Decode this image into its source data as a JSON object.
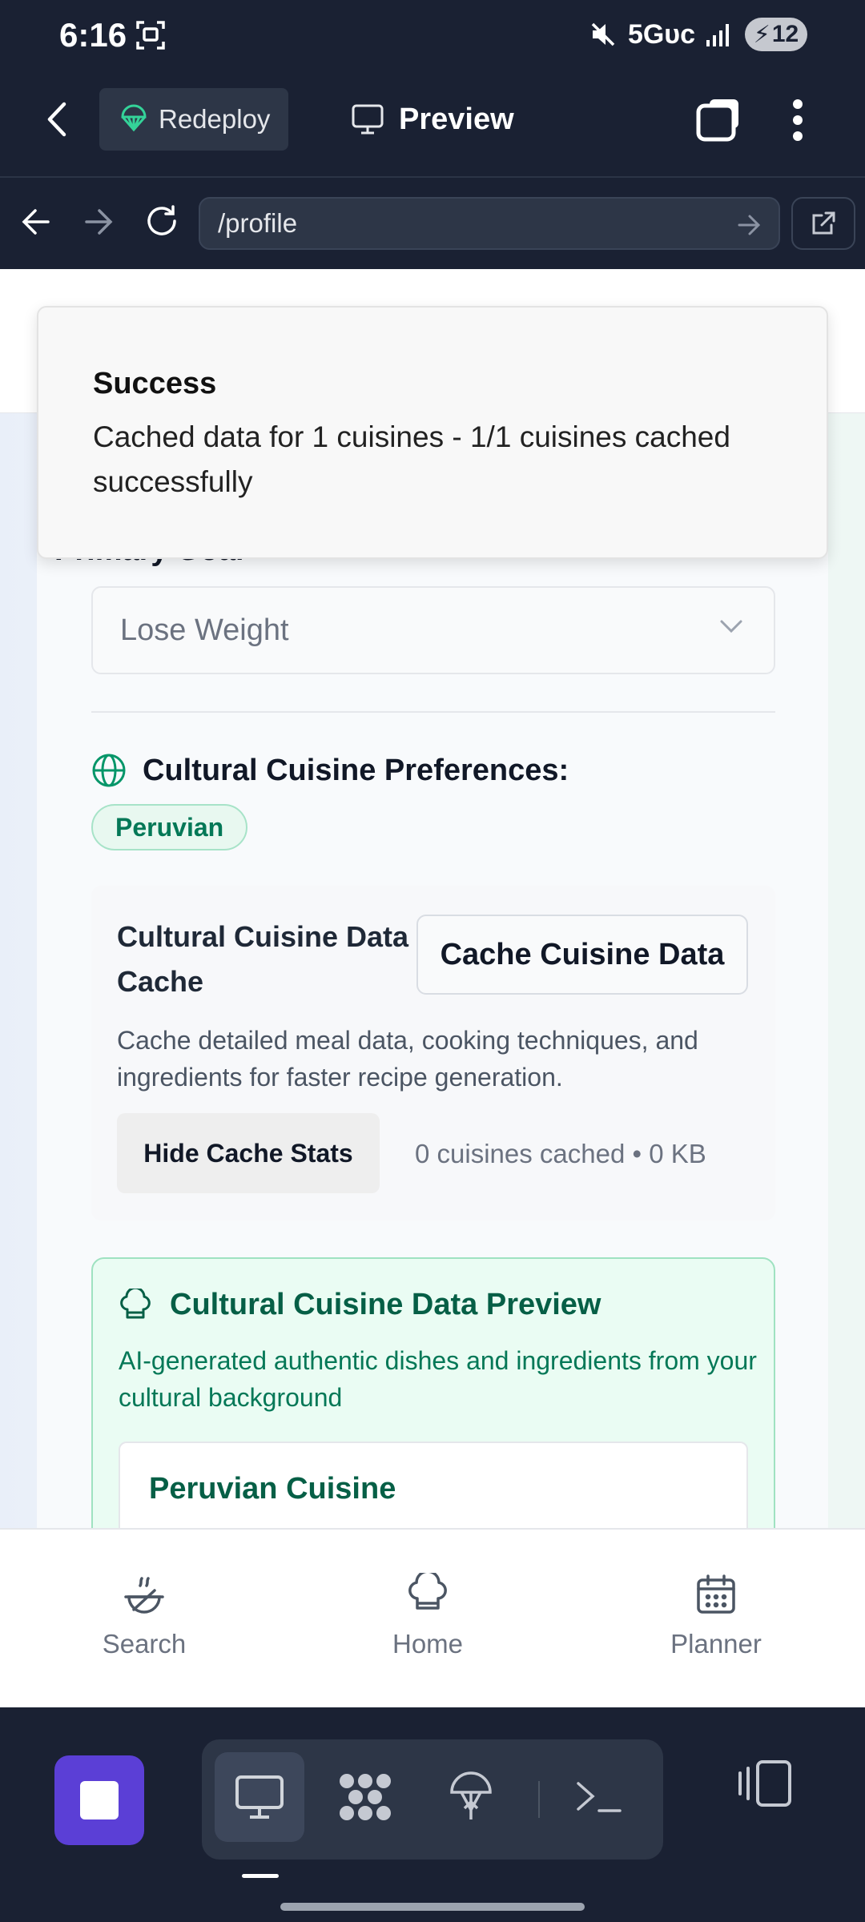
{
  "status_bar": {
    "time": "6:16",
    "network": "5Gᴜᴄ",
    "battery": "12"
  },
  "header": {
    "redeploy_label": "Redeploy",
    "preview_label": "Preview"
  },
  "browser": {
    "url": "/profile"
  },
  "page": {
    "primary_goal_label": "Primary Goal",
    "primary_goal_value": "Lose Weight",
    "cuisine_prefs_heading": "Cultural Cuisine Preferences:",
    "selected_cuisine": "Peruvian",
    "cache": {
      "title": "Cultural Cuisine Data Cache",
      "button": "Cache Cuisine Data",
      "description": "Cache detailed meal data, cooking techniques, and ingredients for faster recipe generation.",
      "hide_stats_button": "Hide Cache Stats",
      "stats": "0 cuisines cached • 0 KB"
    },
    "preview": {
      "heading": "Cultural Cuisine Data Preview",
      "description": "AI-generated authentic dishes and ingredients from your cultural background",
      "cuisine_name": "Peruvian Cuisine"
    }
  },
  "toast": {
    "title": "Success",
    "message": "Cached data for 1 cuisines - 1/1 cuisines cached successfully"
  },
  "bottom_nav": {
    "items": [
      {
        "label": "Search",
        "icon": "search-dish-icon"
      },
      {
        "label": "Home",
        "icon": "chef-hat-icon"
      },
      {
        "label": "Planner",
        "icon": "calendar-icon"
      }
    ]
  },
  "colors": {
    "accent_green": "#047857",
    "dock_purple": "#5b3fd6",
    "dark_bg": "#1a2133"
  }
}
